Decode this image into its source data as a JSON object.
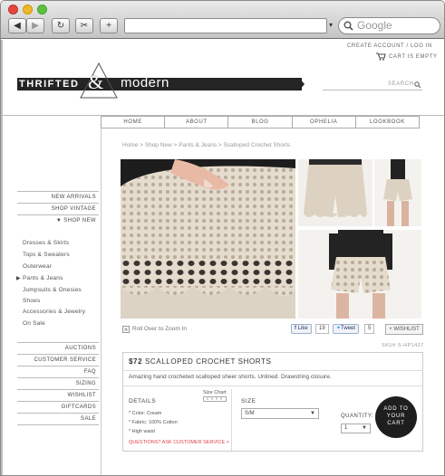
{
  "browser": {
    "search_placeholder": "Google"
  },
  "header": {
    "account_link": "CREATE ACCOUNT / LOG IN",
    "cart_status": "CART IS EMPTY",
    "logo_left": "THRIFTED",
    "logo_amp": "&",
    "logo_right": "modern",
    "search_placeholder": "SEARCH"
  },
  "nav": {
    "items": [
      "HOME",
      "ABOUT",
      "BLOG",
      "OPHELIA",
      "LOOKBOOK"
    ]
  },
  "sidebar": {
    "top_items": [
      "NEW ARRIVALS",
      "SHOP VINTAGE",
      "SHOP NEW"
    ],
    "sub_items": [
      "Dresses & Skirts",
      "Tops & Sweaters",
      "Outerwear",
      "Pants & Jeans",
      "Jumpsuits & Onesies",
      "Shoes",
      "Accessories & Jewelry",
      "On Sale"
    ],
    "bottom_items": [
      "AUCTIONS",
      "CUSTOMER SERVICE",
      "FAQ",
      "SIZING",
      "WISHLIST",
      "GIFTCARDS",
      "SALE"
    ]
  },
  "breadcrumb": "Home > Shop New > Pants & Jeans > Scalloped Crochet Shorts",
  "product": {
    "zoom_hint": "Roll Over to Zoom In",
    "like_label": "Like",
    "like_count": "19",
    "tweet_label": "Tweet",
    "tweet_count": "5",
    "wishlist_label": "+ WISHLIST",
    "sku": "SKU# S-HP1437",
    "price": "$72",
    "name": "SCALLOPED CROCHET SHORTS",
    "description": "Amazing hand crocheted scalloped sheer shorts. Unlined. Drawstring closure.",
    "details_label": "DETAILS",
    "size_chart_label": "Size Chart",
    "details": [
      "* Color: Cream",
      "* Fabric: 100% Cotton",
      "* High waist"
    ],
    "questions": "QUESTIONS? ASK CUSTOMER SERVICE >",
    "size_label": "SIZE",
    "size_value": "S/M",
    "quantity_label": "QUANTITY:",
    "quantity_value": "1",
    "add_to_cart": "ADD TO YOUR CART"
  }
}
